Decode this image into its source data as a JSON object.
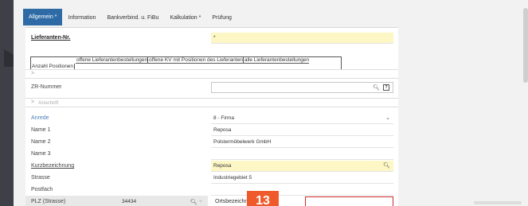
{
  "tabs": [
    {
      "label": "Allgemein *",
      "active": true
    },
    {
      "label": "Information",
      "active": false
    },
    {
      "label": "Bankverbind. u. FiBu",
      "active": false
    },
    {
      "label": "Kalkulation *",
      "active": false
    },
    {
      "label": "Prüfung",
      "active": false
    }
  ],
  "lieferanten": {
    "label": "Lieferanten-Nr.",
    "value": "*"
  },
  "grid": {
    "headers": [
      "offene Lieferantenbestellungen",
      "offene KV mit Positionen des Lieferanten",
      "alle Lieferantenbestellungen"
    ],
    "row_label": "Anzahl Positionen"
  },
  "zr": {
    "label": "ZR-Nummer",
    "value": ""
  },
  "section_anschrift": {
    "label": "Anschrift"
  },
  "fields": [
    {
      "label": "Anrede",
      "value": "8 - Firma"
    },
    {
      "label": "Name 1",
      "value": "Reposa"
    },
    {
      "label": "Name 2",
      "value": "Polstermöbelwerk GmbH"
    },
    {
      "label": "Name 3",
      "value": ""
    },
    {
      "label": "Kurzbezeichnung",
      "value": "Reposa"
    },
    {
      "label": "Strasse",
      "value": "Industriegebiet 5"
    },
    {
      "label": "Postfach",
      "value": ""
    }
  ],
  "plz": {
    "label": "PLZ (Strasse)",
    "value": "34434"
  },
  "ort": {
    "label": "Ortsbezeichnung",
    "value": ""
  },
  "step_badge": "13",
  "colors": {
    "tab_active": "#2e6ba6",
    "required_field": "#fdf6c5",
    "error_border": "#d02a2a",
    "badge": "#ef5a2a"
  }
}
